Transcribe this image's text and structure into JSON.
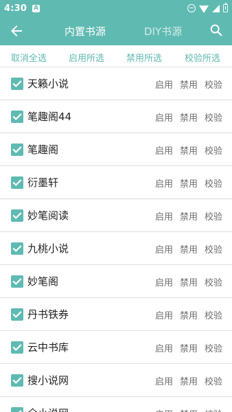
{
  "status_bar": {
    "time": "4:30",
    "notification_letter": "A"
  },
  "toolbar": {
    "tab_builtin": "内置书源",
    "tab_diy": "DIY书源",
    "accent_color": "#5fbab2"
  },
  "actions": {
    "cancel_all": "取消全选",
    "enable_selected": "启用所选",
    "disable_selected": "禁用所选",
    "verify_selected": "校验所选"
  },
  "row_buttons": {
    "enable": "启用",
    "disable": "禁用",
    "verify": "校验"
  },
  "sources": [
    {
      "name": "天籁小说",
      "checked": true
    },
    {
      "name": "笔趣阁44",
      "checked": true
    },
    {
      "name": "笔趣阁",
      "checked": true
    },
    {
      "name": "衍墨轩",
      "checked": true
    },
    {
      "name": "妙笔阅读",
      "checked": true
    },
    {
      "name": "九桃小说",
      "checked": true
    },
    {
      "name": "妙笔阁",
      "checked": true
    },
    {
      "name": "丹书铁券",
      "checked": true
    },
    {
      "name": "云中书库",
      "checked": true
    },
    {
      "name": "搜小说网",
      "checked": true
    },
    {
      "name": "全小说网",
      "checked": true
    }
  ]
}
